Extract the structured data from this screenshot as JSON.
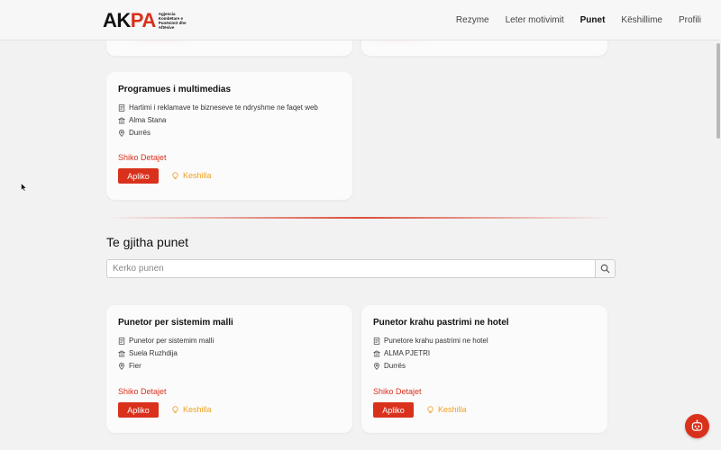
{
  "header": {
    "logo": {
      "mark_main": "AK",
      "mark_accent": "PA",
      "subtitle": "Agjencia Kombëtare e Punësimit dhe Aftësive"
    },
    "nav": [
      "Rezyme",
      "Leter motivimit",
      "Punet",
      "Këshillime",
      "Profili"
    ],
    "active_nav": "Punet"
  },
  "featured_jobs": [
    {
      "title": "Programues i multimedias",
      "description": "Hartimi i reklamave te bizneseve te ndryshme ne faqet web",
      "company": "Alma Stana",
      "location": "Durrës",
      "details_label": "Shiko Detajet",
      "apply_label": "Apliko",
      "advice_label": "Keshilla"
    }
  ],
  "all_jobs_section": {
    "title": "Te gjitha punet",
    "search_placeholder": "Kerko punen"
  },
  "jobs": [
    {
      "title": "Punetor per sistemim malli",
      "description": "Punetor per sistemim malli",
      "company": "Suela Ruzhdija",
      "location": "Fier",
      "details_label": "Shiko Detajet",
      "apply_label": "Apliko",
      "advice_label": "Keshilla"
    },
    {
      "title": "Punetor krahu pastrimi ne hotel",
      "description": "Punetore krahu pastrimi ne hotel",
      "company": "ALMA PJETRI",
      "location": "Durrës",
      "details_label": "Shiko Detajet",
      "apply_label": "Apliko",
      "advice_label": "Keshilla"
    }
  ],
  "colors": {
    "accent": "#d9311c",
    "advice": "#f0a020",
    "background": "#f2f2f2",
    "card": "#fbfbfb"
  },
  "icons": [
    "document-icon",
    "building-icon",
    "location-icon",
    "lightbulb-icon",
    "search-icon",
    "chatbot-icon"
  ]
}
